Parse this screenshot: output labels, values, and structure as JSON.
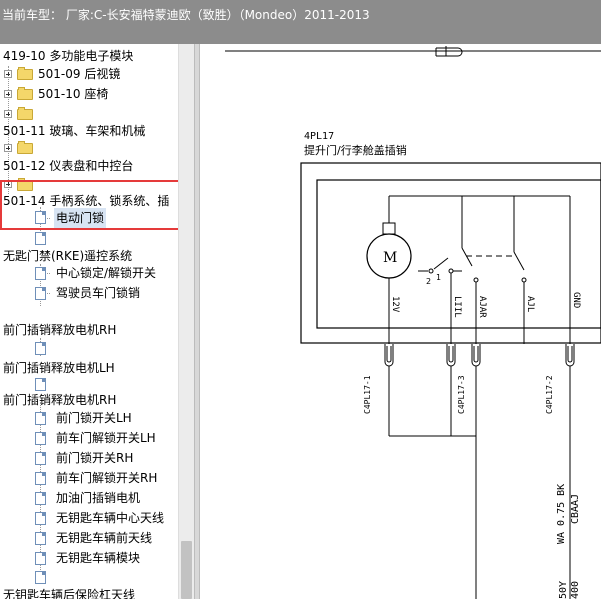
{
  "titlebar": {
    "text": "当前车型：  厂家:C-长安福特蒙迪欧（致胜）（Mondeo）2011-2013"
  },
  "tree": {
    "items": [
      {
        "label": "419-10 多功能电子模块"
      },
      {
        "label": "501-09 后视镜"
      },
      {
        "label": "501-10 座椅"
      },
      {
        "label": ""
      },
      {
        "label": "501-11 玻璃、车架和机械"
      },
      {
        "label": ""
      },
      {
        "label": "501-12 仪表盘和中控台"
      },
      {
        "label": ""
      },
      {
        "label": "501-14 手柄系统、锁系统、插"
      },
      {
        "label": "电动门锁"
      },
      {
        "label": ""
      },
      {
        "label": "无匙门禁(RKE)遥控系统"
      },
      {
        "label": "中心锁定/解锁开关"
      },
      {
        "label": "驾驶员车门锁销"
      },
      {
        "label": "前门插销释放电机RH"
      },
      {
        "label": ""
      },
      {
        "label": "前门插销释放电机LH"
      },
      {
        "label": ""
      },
      {
        "label": "前门插销释放电机RH"
      },
      {
        "label": "前门锁开关LH"
      },
      {
        "label": "前车门解锁开关LH"
      },
      {
        "label": "前门锁开关RH"
      },
      {
        "label": "前车门解锁开关RH"
      },
      {
        "label": "加油门插销电机"
      },
      {
        "label": "无钥匙车辆中心天线"
      },
      {
        "label": "无钥匙车辆前天线"
      },
      {
        "label": "无钥匙车辆模块"
      },
      {
        "label": ""
      },
      {
        "label": "无钥匙车辆后保险杠天线"
      }
    ]
  },
  "diagram": {
    "component_code": "4PL17",
    "component_name": "提升门/行李舱盖插销",
    "motor_label": "M",
    "switch_labels": [
      "2",
      "1"
    ],
    "pins": [
      "12V",
      "LIIL",
      "AJAR",
      "AJL",
      "GND"
    ],
    "connectors": [
      "C4PL17-1",
      "C4PL17-3",
      "C4PL17-2"
    ],
    "wire_label_1": "WA 0.75 BK",
    "wire_label_2": "CBAAJ",
    "wire_label_3": "50Y",
    "wire_label_4": "400"
  },
  "colors": {
    "titlebar": "#8c8c8c",
    "highlight": "#e53a3a",
    "selection": "#d8e4f3"
  }
}
